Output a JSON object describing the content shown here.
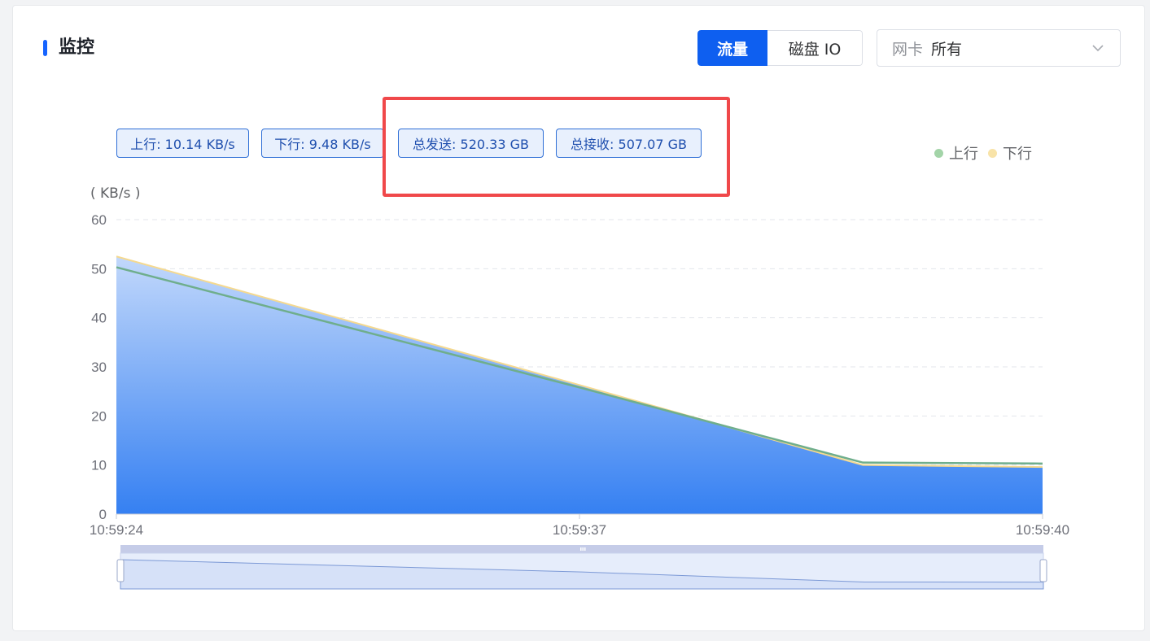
{
  "header": {
    "title": "监控"
  },
  "tabs": [
    {
      "label": "流量",
      "active": true
    },
    {
      "label": "磁盘 IO",
      "active": false
    }
  ],
  "nic_select": {
    "prefix": "网卡",
    "value": "所有"
  },
  "stats": {
    "up": "上行: 10.14 KB/s",
    "down": "下行: 9.48 KB/s",
    "total_sent": "总发送: 520.33 GB",
    "total_recv": "总接收: 507.07 GB"
  },
  "colors": {
    "accent": "#0e5ff0",
    "highlight": "#f0484a",
    "up_series": "#a3d4a8",
    "down_series": "#f8e3a8",
    "area": "#3b82f6"
  },
  "chart_data": {
    "type": "area",
    "unit_label": "( KB/s )",
    "ylim": [
      0,
      60
    ],
    "y_ticks": [
      0,
      10,
      20,
      30,
      40,
      50,
      60
    ],
    "x_tick_labels": [
      "10:59:24",
      "10:59:37",
      "10:59:40"
    ],
    "grid": true,
    "legend_position": "top-right",
    "series": [
      {
        "name": "上行",
        "x": [
          0,
          0.5,
          0.806,
          1
        ],
        "values": [
          50.3,
          25.8,
          10.5,
          10.3
        ]
      },
      {
        "name": "下行",
        "x": [
          0,
          0.5,
          0.806,
          1
        ],
        "values": [
          52.5,
          26.3,
          10.0,
          9.6
        ]
      }
    ]
  }
}
